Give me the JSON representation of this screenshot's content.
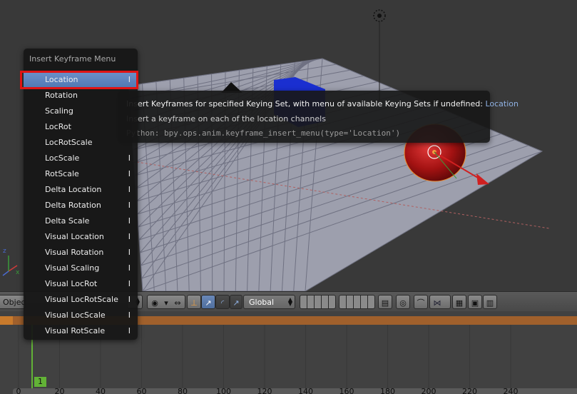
{
  "menu": {
    "title": "Insert Keyframe Menu",
    "items": [
      {
        "label": "Location",
        "key": "I",
        "selected": true
      },
      {
        "label": "Rotation",
        "key": ""
      },
      {
        "label": "Scaling",
        "key": ""
      },
      {
        "label": "LocRot",
        "key": ""
      },
      {
        "label": "LocRotScale",
        "key": ""
      },
      {
        "label": "LocScale",
        "key": "I"
      },
      {
        "label": "RotScale",
        "key": "I"
      },
      {
        "label": "Delta Location",
        "key": "I"
      },
      {
        "label": "Delta Rotation",
        "key": "I"
      },
      {
        "label": "Delta Scale",
        "key": "I"
      },
      {
        "label": "Visual Location",
        "key": "I"
      },
      {
        "label": "Visual Rotation",
        "key": "I"
      },
      {
        "label": "Visual Scaling",
        "key": "I"
      },
      {
        "label": "Visual LocRot",
        "key": "I"
      },
      {
        "label": "Visual LocRotScale",
        "key": "I"
      },
      {
        "label": "Visual LocScale",
        "key": "I"
      },
      {
        "label": "Visual RotScale",
        "key": "I"
      }
    ]
  },
  "tooltip": {
    "description": "Insert Keyframes for specified Keying Set, with menu of available Keying Sets if undefined:",
    "highlight": "Location",
    "detail": "Insert a keyframe on each of the location channels",
    "python": "Python: bpy.ops.anim.keyframe_insert_menu(type='Location')"
  },
  "toolbar": {
    "mode_label": "Objec",
    "orientation": "Global"
  },
  "timeline": {
    "current_frame": "1",
    "ruler_ticks": [
      "0",
      "20",
      "40",
      "60",
      "80",
      "100",
      "120",
      "140",
      "160",
      "180",
      "200",
      "220",
      "240"
    ]
  },
  "colors": {
    "selection": "#5a82bd",
    "highlight_outline": "#e01414",
    "tooltip_highlight": "#8fb1e3",
    "frame_cursor": "#62b236",
    "timeline_band": "#a0602c"
  }
}
